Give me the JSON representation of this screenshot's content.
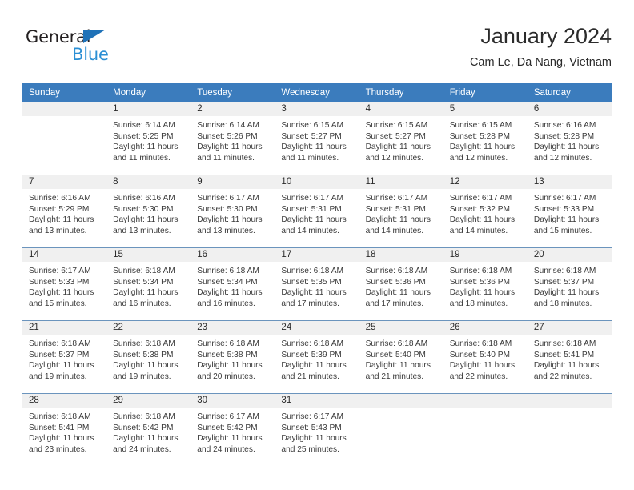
{
  "brand": {
    "name_part1": "General",
    "name_part2": "Blue",
    "triangle_icon": "triangle-icon",
    "accent_color": "#1f72b8",
    "secondary_color": "#2b8fd4"
  },
  "header": {
    "title": "January 2024",
    "subtitle": "Cam Le, Da Nang, Vietnam"
  },
  "calendar": {
    "header_color": "#3b7cbd",
    "daynum_band_color": "#f0f0f0",
    "weekday_headers": [
      "Sunday",
      "Monday",
      "Tuesday",
      "Wednesday",
      "Thursday",
      "Friday",
      "Saturday"
    ],
    "weeks": [
      [
        {
          "day": "",
          "lines": []
        },
        {
          "day": "1",
          "lines": [
            "Sunrise: 6:14 AM",
            "Sunset: 5:25 PM",
            "Daylight: 11 hours",
            "and 11 minutes."
          ]
        },
        {
          "day": "2",
          "lines": [
            "Sunrise: 6:14 AM",
            "Sunset: 5:26 PM",
            "Daylight: 11 hours",
            "and 11 minutes."
          ]
        },
        {
          "day": "3",
          "lines": [
            "Sunrise: 6:15 AM",
            "Sunset: 5:27 PM",
            "Daylight: 11 hours",
            "and 11 minutes."
          ]
        },
        {
          "day": "4",
          "lines": [
            "Sunrise: 6:15 AM",
            "Sunset: 5:27 PM",
            "Daylight: 11 hours",
            "and 12 minutes."
          ]
        },
        {
          "day": "5",
          "lines": [
            "Sunrise: 6:15 AM",
            "Sunset: 5:28 PM",
            "Daylight: 11 hours",
            "and 12 minutes."
          ]
        },
        {
          "day": "6",
          "lines": [
            "Sunrise: 6:16 AM",
            "Sunset: 5:28 PM",
            "Daylight: 11 hours",
            "and 12 minutes."
          ]
        }
      ],
      [
        {
          "day": "7",
          "lines": [
            "Sunrise: 6:16 AM",
            "Sunset: 5:29 PM",
            "Daylight: 11 hours",
            "and 13 minutes."
          ]
        },
        {
          "day": "8",
          "lines": [
            "Sunrise: 6:16 AM",
            "Sunset: 5:30 PM",
            "Daylight: 11 hours",
            "and 13 minutes."
          ]
        },
        {
          "day": "9",
          "lines": [
            "Sunrise: 6:17 AM",
            "Sunset: 5:30 PM",
            "Daylight: 11 hours",
            "and 13 minutes."
          ]
        },
        {
          "day": "10",
          "lines": [
            "Sunrise: 6:17 AM",
            "Sunset: 5:31 PM",
            "Daylight: 11 hours",
            "and 14 minutes."
          ]
        },
        {
          "day": "11",
          "lines": [
            "Sunrise: 6:17 AM",
            "Sunset: 5:31 PM",
            "Daylight: 11 hours",
            "and 14 minutes."
          ]
        },
        {
          "day": "12",
          "lines": [
            "Sunrise: 6:17 AM",
            "Sunset: 5:32 PM",
            "Daylight: 11 hours",
            "and 14 minutes."
          ]
        },
        {
          "day": "13",
          "lines": [
            "Sunrise: 6:17 AM",
            "Sunset: 5:33 PM",
            "Daylight: 11 hours",
            "and 15 minutes."
          ]
        }
      ],
      [
        {
          "day": "14",
          "lines": [
            "Sunrise: 6:17 AM",
            "Sunset: 5:33 PM",
            "Daylight: 11 hours",
            "and 15 minutes."
          ]
        },
        {
          "day": "15",
          "lines": [
            "Sunrise: 6:18 AM",
            "Sunset: 5:34 PM",
            "Daylight: 11 hours",
            "and 16 minutes."
          ]
        },
        {
          "day": "16",
          "lines": [
            "Sunrise: 6:18 AM",
            "Sunset: 5:34 PM",
            "Daylight: 11 hours",
            "and 16 minutes."
          ]
        },
        {
          "day": "17",
          "lines": [
            "Sunrise: 6:18 AM",
            "Sunset: 5:35 PM",
            "Daylight: 11 hours",
            "and 17 minutes."
          ]
        },
        {
          "day": "18",
          "lines": [
            "Sunrise: 6:18 AM",
            "Sunset: 5:36 PM",
            "Daylight: 11 hours",
            "and 17 minutes."
          ]
        },
        {
          "day": "19",
          "lines": [
            "Sunrise: 6:18 AM",
            "Sunset: 5:36 PM",
            "Daylight: 11 hours",
            "and 18 minutes."
          ]
        },
        {
          "day": "20",
          "lines": [
            "Sunrise: 6:18 AM",
            "Sunset: 5:37 PM",
            "Daylight: 11 hours",
            "and 18 minutes."
          ]
        }
      ],
      [
        {
          "day": "21",
          "lines": [
            "Sunrise: 6:18 AM",
            "Sunset: 5:37 PM",
            "Daylight: 11 hours",
            "and 19 minutes."
          ]
        },
        {
          "day": "22",
          "lines": [
            "Sunrise: 6:18 AM",
            "Sunset: 5:38 PM",
            "Daylight: 11 hours",
            "and 19 minutes."
          ]
        },
        {
          "day": "23",
          "lines": [
            "Sunrise: 6:18 AM",
            "Sunset: 5:38 PM",
            "Daylight: 11 hours",
            "and 20 minutes."
          ]
        },
        {
          "day": "24",
          "lines": [
            "Sunrise: 6:18 AM",
            "Sunset: 5:39 PM",
            "Daylight: 11 hours",
            "and 21 minutes."
          ]
        },
        {
          "day": "25",
          "lines": [
            "Sunrise: 6:18 AM",
            "Sunset: 5:40 PM",
            "Daylight: 11 hours",
            "and 21 minutes."
          ]
        },
        {
          "day": "26",
          "lines": [
            "Sunrise: 6:18 AM",
            "Sunset: 5:40 PM",
            "Daylight: 11 hours",
            "and 22 minutes."
          ]
        },
        {
          "day": "27",
          "lines": [
            "Sunrise: 6:18 AM",
            "Sunset: 5:41 PM",
            "Daylight: 11 hours",
            "and 22 minutes."
          ]
        }
      ],
      [
        {
          "day": "28",
          "lines": [
            "Sunrise: 6:18 AM",
            "Sunset: 5:41 PM",
            "Daylight: 11 hours",
            "and 23 minutes."
          ]
        },
        {
          "day": "29",
          "lines": [
            "Sunrise: 6:18 AM",
            "Sunset: 5:42 PM",
            "Daylight: 11 hours",
            "and 24 minutes."
          ]
        },
        {
          "day": "30",
          "lines": [
            "Sunrise: 6:17 AM",
            "Sunset: 5:42 PM",
            "Daylight: 11 hours",
            "and 24 minutes."
          ]
        },
        {
          "day": "31",
          "lines": [
            "Sunrise: 6:17 AM",
            "Sunset: 5:43 PM",
            "Daylight: 11 hours",
            "and 25 minutes."
          ]
        },
        {
          "day": "",
          "lines": []
        },
        {
          "day": "",
          "lines": []
        },
        {
          "day": "",
          "lines": []
        }
      ]
    ]
  }
}
